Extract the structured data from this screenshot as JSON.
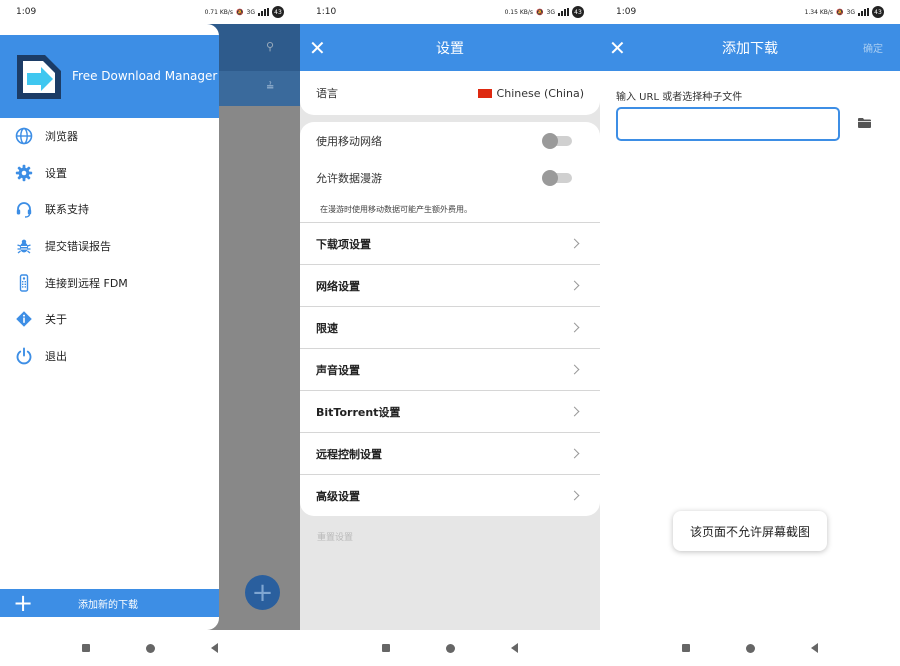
{
  "panel1": {
    "status": {
      "time": "1:09",
      "net_speed": "0.71 KB/s",
      "network": "3G",
      "battery": "43"
    },
    "app_name": "Free Download Manager",
    "menu": [
      {
        "label": "浏览器",
        "icon": "globe-icon"
      },
      {
        "label": "设置",
        "icon": "gear-icon"
      },
      {
        "label": "联系支持",
        "icon": "headset-icon"
      },
      {
        "label": "提交错误报告",
        "icon": "bug-icon"
      },
      {
        "label": "连接到远程 FDM",
        "icon": "remote-icon"
      },
      {
        "label": "关于",
        "icon": "info-icon"
      },
      {
        "label": "退出",
        "icon": "power-icon"
      }
    ],
    "footer_label": "添加新的下载"
  },
  "panel2": {
    "status": {
      "time": "1:10",
      "net_speed": "0.15 KB/s",
      "network": "3G",
      "battery": "43"
    },
    "title": "设置",
    "language_label": "语言",
    "language_value": "Chinese (China)",
    "toggles": [
      {
        "label": "使用移动网络",
        "on": false
      },
      {
        "label": "允许数据漫游",
        "on": false
      }
    ],
    "roaming_note": "在漫游时使用移动数据可能产生额外费用。",
    "rows": [
      "下载项设置",
      "网络设置",
      "限速",
      "声音设置",
      "BitTorrent设置",
      "远程控制设置",
      "高级设置"
    ],
    "reset_label": "重置设置"
  },
  "panel3": {
    "status": {
      "time": "1:09",
      "net_speed": "1.34 KB/s",
      "network": "3G",
      "battery": "43"
    },
    "title": "添加下载",
    "confirm_label": "确定",
    "field_label": "输入 URL 或者选择种子文件",
    "url_value": "",
    "toast": "该页面不允许屏幕截图"
  },
  "colors": {
    "primary": "#3d8ee5",
    "dim_background": "#888888",
    "settings_background": "#e6e6e6"
  }
}
